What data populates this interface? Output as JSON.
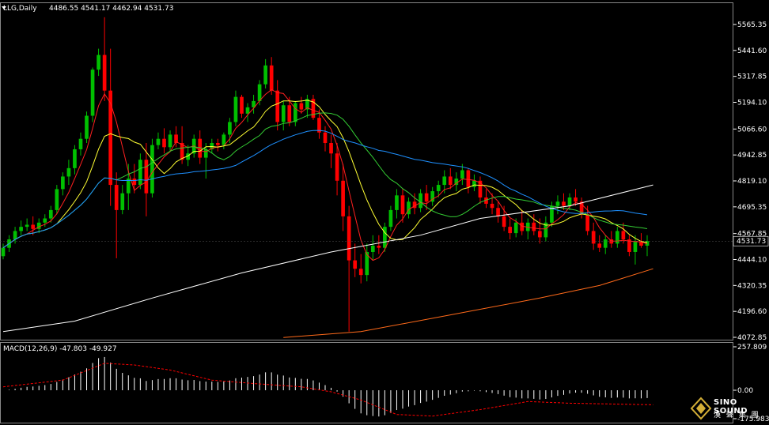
{
  "header": {
    "symbol": "LLG,Daily",
    "ohlc": "4486.55 4541.17 4462.94 4531.73"
  },
  "macd_header": {
    "label": "MACD(12,26,9) -47.803 -49.927"
  },
  "price_axis": {
    "ticks": [
      "5565.35",
      "5441.60",
      "5317.85",
      "5194.10",
      "5066.60",
      "4942.85",
      "4819.10",
      "4695.35",
      "4567.85",
      "4444.10",
      "4320.35",
      "4196.60",
      "4072.85"
    ],
    "current_price": "4531.73"
  },
  "macd_axis": {
    "ticks": [
      "257.809",
      "0.00",
      "-175.983"
    ]
  },
  "logo": {
    "brand": "SINO SOUND",
    "sub": "漢 聲 集 團"
  },
  "colors": {
    "background": "#000000",
    "up_candle": "#00c000",
    "down_candle": "#ff0000",
    "ma_fast": "#ff2020",
    "ma_yellow": "#ffff33",
    "ma_green": "#33cc33",
    "ma_blue": "#1e90ff",
    "ma_white": "#ffffff",
    "ma_orange": "#ff6a1a",
    "macd_hist": "#ffffff",
    "macd_signal": "#ff0000"
  },
  "chart_data": {
    "type": "candlestick",
    "title": "LLG,Daily",
    "ylim": [
      4072.85,
      5600
    ],
    "candles": [
      [
        4460,
        4520,
        4445,
        4500
      ],
      [
        4500,
        4560,
        4480,
        4540
      ],
      [
        4540,
        4600,
        4520,
        4580
      ],
      [
        4580,
        4630,
        4560,
        4600
      ],
      [
        4600,
        4640,
        4580,
        4610
      ],
      [
        4610,
        4650,
        4560,
        4590
      ],
      [
        4590,
        4640,
        4570,
        4620
      ],
      [
        4620,
        4660,
        4600,
        4640
      ],
      [
        4640,
        4700,
        4620,
        4680
      ],
      [
        4680,
        4800,
        4660,
        4780
      ],
      [
        4780,
        4860,
        4750,
        4840
      ],
      [
        4840,
        4920,
        4800,
        4880
      ],
      [
        4880,
        4990,
        4850,
        4970
      ],
      [
        4970,
        5050,
        4940,
        5020
      ],
      [
        5020,
        5150,
        5000,
        5130
      ],
      [
        5130,
        5360,
        5100,
        5350
      ],
      [
        5350,
        5450,
        5320,
        5420
      ],
      [
        5420,
        5600,
        5200,
        5250
      ],
      [
        5250,
        5450,
        4700,
        4800
      ],
      [
        4800,
        4860,
        4450,
        4680
      ],
      [
        4680,
        4800,
        4660,
        4760
      ],
      [
        4760,
        4900,
        4680,
        4830
      ],
      [
        4830,
        4900,
        4760,
        4800
      ],
      [
        4800,
        4950,
        4780,
        4920
      ],
      [
        4920,
        5000,
        4650,
        4760
      ],
      [
        4760,
        5020,
        4740,
        4990
      ],
      [
        4990,
        5050,
        4970,
        5020
      ],
      [
        5020,
        5070,
        4950,
        4980
      ],
      [
        4980,
        5060,
        4960,
        5040
      ],
      [
        5040,
        5080,
        4980,
        5000
      ],
      [
        5000,
        5080,
        4900,
        4920
      ],
      [
        4920,
        4990,
        4890,
        4950
      ],
      [
        4950,
        5040,
        4930,
        5020
      ],
      [
        5020,
        5060,
        4900,
        4930
      ],
      [
        4930,
        5000,
        4830,
        4970
      ],
      [
        4970,
        5020,
        4950,
        5000
      ],
      [
        5000,
        5020,
        4960,
        4990
      ],
      [
        4990,
        5050,
        4970,
        5040
      ],
      [
        5040,
        5120,
        5000,
        5100
      ],
      [
        5100,
        5250,
        5080,
        5220
      ],
      [
        5220,
        5230,
        5120,
        5140
      ],
      [
        5140,
        5190,
        5100,
        5170
      ],
      [
        5170,
        5230,
        5140,
        5200
      ],
      [
        5200,
        5300,
        5180,
        5280
      ],
      [
        5280,
        5400,
        5260,
        5370
      ],
      [
        5370,
        5410,
        5230,
        5250
      ],
      [
        5250,
        5300,
        5060,
        5100
      ],
      [
        5100,
        5200,
        5060,
        5180
      ],
      [
        5180,
        5220,
        5080,
        5100
      ],
      [
        5100,
        5200,
        5080,
        5190
      ],
      [
        5190,
        5220,
        5140,
        5160
      ],
      [
        5160,
        5230,
        5120,
        5210
      ],
      [
        5210,
        5230,
        5110,
        5120
      ],
      [
        5120,
        5160,
        5020,
        5050
      ],
      [
        5050,
        5080,
        4960,
        5000
      ],
      [
        5000,
        5040,
        4880,
        4950
      ],
      [
        4950,
        5000,
        4750,
        4820
      ],
      [
        4820,
        4900,
        4580,
        4650
      ],
      [
        4650,
        4700,
        4100,
        4440
      ],
      [
        4440,
        4520,
        4360,
        4400
      ],
      [
        4400,
        4470,
        4330,
        4370
      ],
      [
        4370,
        4520,
        4340,
        4480
      ],
      [
        4480,
        4560,
        4440,
        4510
      ],
      [
        4510,
        4560,
        4470,
        4500
      ],
      [
        4500,
        4620,
        4480,
        4600
      ],
      [
        4600,
        4700,
        4580,
        4680
      ],
      [
        4680,
        4780,
        4640,
        4750
      ],
      [
        4750,
        4780,
        4620,
        4660
      ],
      [
        4660,
        4740,
        4640,
        4720
      ],
      [
        4720,
        4760,
        4660,
        4690
      ],
      [
        4690,
        4780,
        4670,
        4760
      ],
      [
        4760,
        4800,
        4680,
        4720
      ],
      [
        4720,
        4790,
        4700,
        4770
      ],
      [
        4770,
        4820,
        4740,
        4800
      ],
      [
        4800,
        4870,
        4760,
        4840
      ],
      [
        4840,
        4880,
        4780,
        4800
      ],
      [
        4800,
        4860,
        4770,
        4830
      ],
      [
        4830,
        4900,
        4800,
        4870
      ],
      [
        4870,
        4880,
        4760,
        4790
      ],
      [
        4790,
        4850,
        4770,
        4820
      ],
      [
        4820,
        4840,
        4710,
        4740
      ],
      [
        4740,
        4780,
        4690,
        4710
      ],
      [
        4710,
        4760,
        4660,
        4690
      ],
      [
        4690,
        4720,
        4620,
        4650
      ],
      [
        4650,
        4700,
        4580,
        4600
      ],
      [
        4600,
        4640,
        4540,
        4570
      ],
      [
        4570,
        4640,
        4550,
        4620
      ],
      [
        4620,
        4680,
        4560,
        4580
      ],
      [
        4580,
        4640,
        4540,
        4620
      ],
      [
        4620,
        4660,
        4560,
        4580
      ],
      [
        4580,
        4640,
        4520,
        4550
      ],
      [
        4550,
        4650,
        4530,
        4620
      ],
      [
        4620,
        4720,
        4600,
        4700
      ],
      [
        4700,
        4750,
        4660,
        4720
      ],
      [
        4720,
        4760,
        4680,
        4700
      ],
      [
        4700,
        4760,
        4680,
        4740
      ],
      [
        4740,
        4780,
        4700,
        4720
      ],
      [
        4720,
        4740,
        4640,
        4660
      ],
      [
        4660,
        4700,
        4560,
        4580
      ],
      [
        4580,
        4620,
        4490,
        4520
      ],
      [
        4520,
        4560,
        4480,
        4500
      ],
      [
        4500,
        4560,
        4470,
        4540
      ],
      [
        4540,
        4580,
        4500,
        4520
      ],
      [
        4520,
        4600,
        4500,
        4580
      ],
      [
        4580,
        4620,
        4520,
        4540
      ],
      [
        4540,
        4560,
        4460,
        4480
      ],
      [
        4480,
        4560,
        4420,
        4530
      ],
      [
        4530,
        4570,
        4500,
        4510
      ],
      [
        4510,
        4560,
        4460,
        4531.73
      ]
    ],
    "ma_white": [
      [
        0,
        4100
      ],
      [
        12,
        4150
      ],
      [
        25,
        4260
      ],
      [
        40,
        4380
      ],
      [
        55,
        4480
      ],
      [
        70,
        4560
      ],
      [
        80,
        4640
      ],
      [
        95,
        4700
      ],
      [
        109,
        4800
      ]
    ],
    "ma_orange": [
      [
        47,
        4072
      ],
      [
        60,
        4100
      ],
      [
        75,
        4180
      ],
      [
        90,
        4260
      ],
      [
        100,
        4320
      ],
      [
        109,
        4400
      ]
    ],
    "macd": {
      "ylim": [
        -175.983,
        257.809
      ],
      "signal": [
        [
          0,
          20
        ],
        [
          10,
          60
        ],
        [
          17,
          160
        ],
        [
          22,
          150
        ],
        [
          28,
          120
        ],
        [
          35,
          60
        ],
        [
          42,
          40
        ],
        [
          50,
          20
        ],
        [
          55,
          -10
        ],
        [
          60,
          -60
        ],
        [
          66,
          -150
        ],
        [
          72,
          -160
        ],
        [
          80,
          -120
        ],
        [
          88,
          -70
        ],
        [
          95,
          -80
        ],
        [
          102,
          -85
        ],
        [
          109,
          -90
        ]
      ]
    }
  }
}
